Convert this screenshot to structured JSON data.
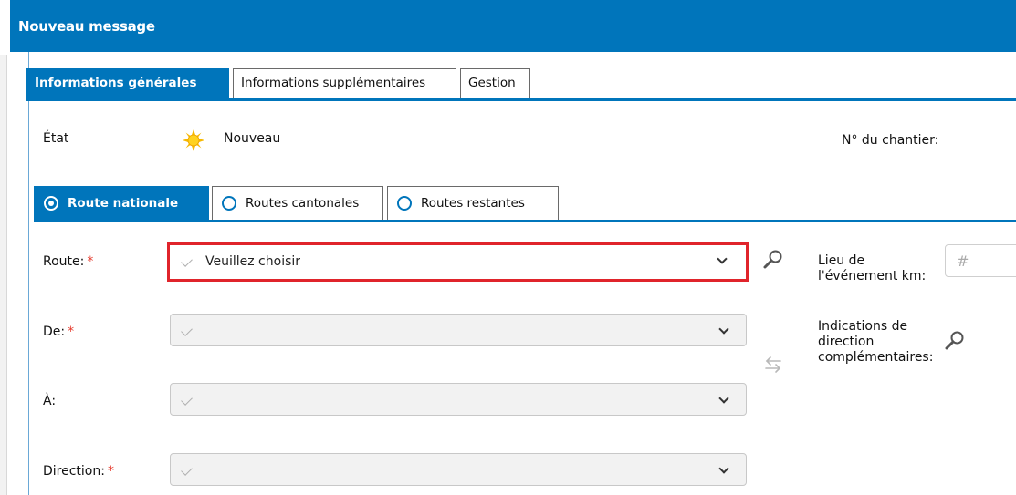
{
  "window": {
    "title": "Nouveau message"
  },
  "tabs": [
    {
      "label": "Informations générales",
      "active": true
    },
    {
      "label": "Informations supplémentaires",
      "active": false
    },
    {
      "label": "Gestion",
      "active": false
    }
  ],
  "status": {
    "label": "État",
    "value": "Nouveau",
    "icon": "sun-icon"
  },
  "site_number": {
    "label": "N° du chantier:"
  },
  "route_tabs": [
    {
      "label": "Route nationale",
      "selected": true
    },
    {
      "label": "Routes cantonales",
      "selected": false
    },
    {
      "label": "Routes restantes",
      "selected": false
    }
  ],
  "form": {
    "route": {
      "label": "Route:",
      "required_mark": "*",
      "value": "Veuillez choisir"
    },
    "from": {
      "label": "De:",
      "required_mark": "*",
      "value": ""
    },
    "to": {
      "label": "À:",
      "value": ""
    },
    "direction": {
      "label": "Direction:",
      "required_mark": "*",
      "value": ""
    },
    "event_location": {
      "label_line1": "Lieu de",
      "label_line2": "l'événement km:",
      "placeholder": "#"
    },
    "direction_hints": {
      "label_line1": "Indications de",
      "label_line2": "direction",
      "label_line3": "complémentaires:"
    }
  },
  "colors": {
    "accent": "#0075bb",
    "required": "#e53a2c",
    "highlight_border": "#e0242b"
  }
}
